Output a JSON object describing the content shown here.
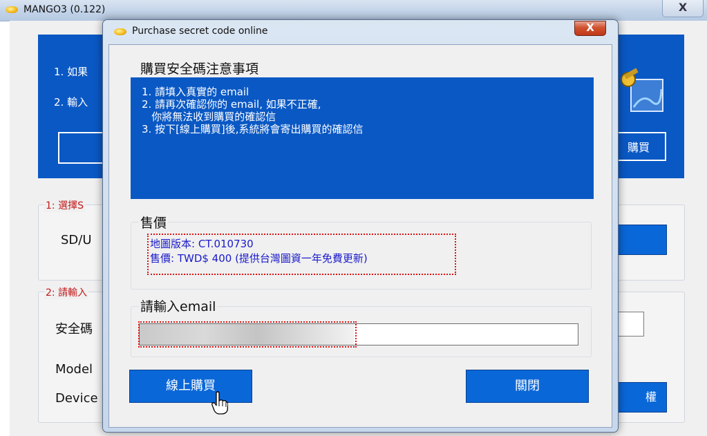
{
  "main_window": {
    "title": "MANGO3 (0.122)",
    "close_glyph": "X",
    "banner": {
      "line1": "1. 如果",
      "line2": "2. 輸入",
      "right_button_label": "購買"
    },
    "section1": {
      "label": "1: 選擇S",
      "field_label": "SD/U"
    },
    "section2": {
      "label": "2: 請輸入",
      "code_label": "安全碼",
      "model_label": "Model",
      "device_label": "Device",
      "auth_button_label": "權"
    }
  },
  "dialog": {
    "title": "Purchase secret code online",
    "close_glyph": "X",
    "notice": {
      "title": "購買安全碼注意事項",
      "lines": [
        "1. 請填入真實的 email",
        "2. 請再次確認你的 email, 如果不正確,",
        "   你將無法收到購買的確認信",
        "3. 按下[線上購買]後,系統將會寄出購買的確認信"
      ]
    },
    "price": {
      "group_label": "售價",
      "map_version": "地圖版本: CT.010730",
      "price_line": "售價: TWD$ 400 (提供台灣圖資一年免費更新)"
    },
    "email": {
      "group_label": "請輸入email",
      "value": ""
    },
    "buttons": {
      "buy": "線上購買",
      "close": "關閉"
    }
  },
  "colors": {
    "banner_blue": "#0a58c4",
    "button_blue": "#0a67d8",
    "highlight_red": "#dd1111",
    "price_text": "#1a1acb"
  }
}
